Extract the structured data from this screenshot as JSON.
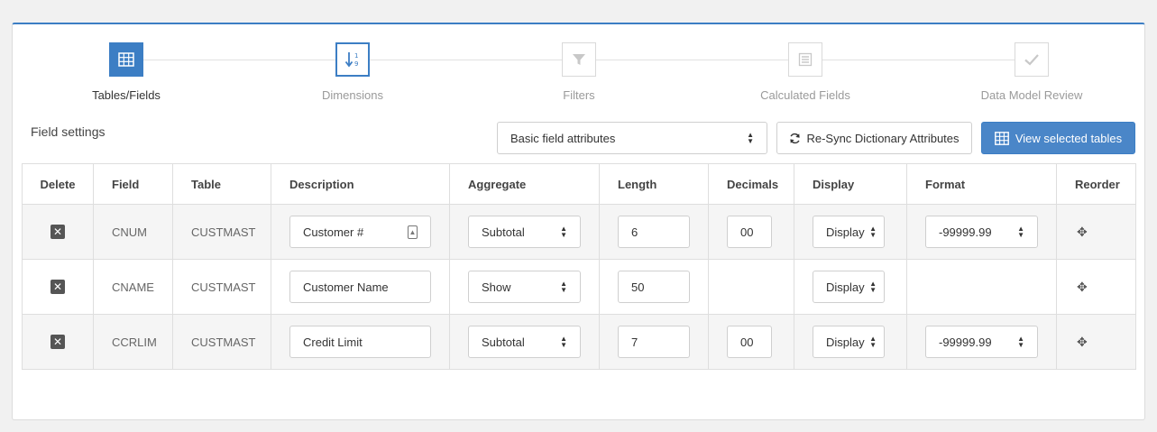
{
  "wizard": {
    "steps": [
      {
        "label": "Tables/Fields",
        "icon": "table-grid-icon",
        "state": "active"
      },
      {
        "label": "Dimensions",
        "icon": "sort-numeric-icon",
        "state": "current"
      },
      {
        "label": "Filters",
        "icon": "filter-icon",
        "state": "pending"
      },
      {
        "label": "Calculated Fields",
        "icon": "list-icon",
        "state": "pending"
      },
      {
        "label": "Data Model Review",
        "icon": "checkmark-icon",
        "state": "pending"
      }
    ]
  },
  "toolbar": {
    "section_title": "Field settings",
    "attributes_select": "Basic field attributes",
    "resync_label": "Re-Sync Dictionary Attributes",
    "view_tables_label": "View selected tables"
  },
  "table": {
    "headers": [
      "Delete",
      "Field",
      "Table",
      "Description",
      "Aggregate",
      "Length",
      "Decimals",
      "Display",
      "Format",
      "Reorder"
    ],
    "rows": [
      {
        "field": "CNUM",
        "table": "CUSTMAST",
        "description": "Customer #",
        "aggregate": "Subtotal",
        "length": "6",
        "decimals": "00",
        "display": "Display",
        "format": "-99999.99"
      },
      {
        "field": "CNAME",
        "table": "CUSTMAST",
        "description": "Customer Name",
        "aggregate": "Show",
        "length": "50",
        "decimals": "",
        "display": "Display",
        "format": ""
      },
      {
        "field": "CCRLIM",
        "table": "CUSTMAST",
        "description": "Credit Limit",
        "aggregate": "Subtotal",
        "length": "7",
        "decimals": "00",
        "display": "Display",
        "format": "-99999.99"
      }
    ]
  },
  "colors": {
    "accent": "#3c7ec4",
    "button_primary": "#4a86c8"
  }
}
